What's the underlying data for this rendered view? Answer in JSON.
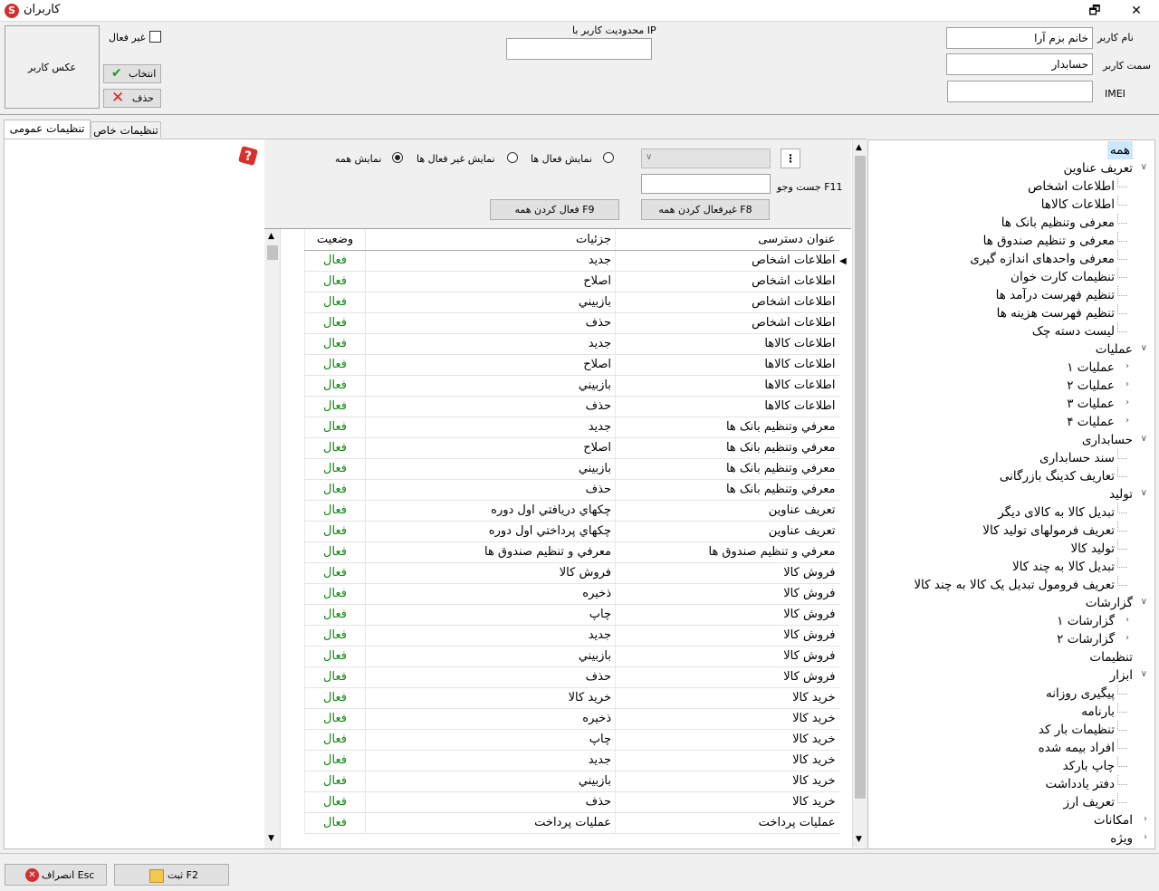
{
  "window": {
    "title": "کاربران",
    "app_logo": "S",
    "restore_glyph": "🗗",
    "close_glyph": "✕"
  },
  "header": {
    "username_label": "نام کاربر",
    "username_value": "خانم بزم آرا",
    "role_label": "سمت کاربر",
    "role_value": "حسابدار",
    "imei_label": "IMEI",
    "imei_value": "",
    "ip_label": "محدودیت کاربر با IP",
    "ip_value": "",
    "inactive_label": "غیر فعال",
    "select_button": "انتخاب",
    "delete_button": "حذف",
    "photo_label": "عکس کاربر"
  },
  "tabs": [
    {
      "label": "تنظیمات عمومی"
    },
    {
      "label": "تنظیمات خاص"
    }
  ],
  "filters": {
    "show_all": "نمایش همه",
    "show_inactive": "نمایش غیر فعال ها",
    "show_active": "نمایش فعال ها",
    "search_label": "جست وجو F11",
    "deactivate_all": "غیرفعال کردن همه F8",
    "activate_all": "فعال کردن همه F9",
    "more_glyph": "⋮"
  },
  "table": {
    "headers": {
      "title": "عنوان دسترسی",
      "details": "جزئیات",
      "status": "وضعیت"
    },
    "rows": [
      {
        "title": "اطلاعات اشخاص",
        "details": "جديد",
        "status": "فعال"
      },
      {
        "title": "اطلاعات اشخاص",
        "details": "اصلاح",
        "status": "فعال"
      },
      {
        "title": "اطلاعات اشخاص",
        "details": "بازبيني",
        "status": "فعال"
      },
      {
        "title": "اطلاعات اشخاص",
        "details": "حذف",
        "status": "فعال"
      },
      {
        "title": "اطلاعات کالاها",
        "details": "جديد",
        "status": "فعال"
      },
      {
        "title": "اطلاعات کالاها",
        "details": "اصلاح",
        "status": "فعال"
      },
      {
        "title": "اطلاعات کالاها",
        "details": "بازبيني",
        "status": "فعال"
      },
      {
        "title": "اطلاعات کالاها",
        "details": "حذف",
        "status": "فعال"
      },
      {
        "title": "معرفي وتنظيم بانک ها",
        "details": "جديد",
        "status": "فعال"
      },
      {
        "title": "معرفي وتنظيم بانک ها",
        "details": "اصلاح",
        "status": "فعال"
      },
      {
        "title": "معرفي وتنظيم بانک ها",
        "details": "بازبيني",
        "status": "فعال"
      },
      {
        "title": "معرفي وتنظيم بانک ها",
        "details": "حذف",
        "status": "فعال"
      },
      {
        "title": "تعريف عناوين",
        "details": "چکهاي دريافتي اول دوره",
        "status": "فعال"
      },
      {
        "title": "تعريف عناوين",
        "details": "چکهاي پرداختي اول دوره",
        "status": "فعال"
      },
      {
        "title": "معرفي و تنظيم صندوق ها",
        "details": "معرفي و تنظيم صندوق ها",
        "status": "فعال"
      },
      {
        "title": "فروش کالا",
        "details": "فروش کالا",
        "status": "فعال"
      },
      {
        "title": "فروش کالا",
        "details": "ذخيره",
        "status": "فعال"
      },
      {
        "title": "فروش کالا",
        "details": "چاپ",
        "status": "فعال"
      },
      {
        "title": "فروش کالا",
        "details": "جديد",
        "status": "فعال"
      },
      {
        "title": "فروش کالا",
        "details": "بازبيني",
        "status": "فعال"
      },
      {
        "title": "فروش کالا",
        "details": "حذف",
        "status": "فعال"
      },
      {
        "title": "خريد کالا",
        "details": "خريد کالا",
        "status": "فعال"
      },
      {
        "title": "خريد کالا",
        "details": "ذخيره",
        "status": "فعال"
      },
      {
        "title": "خريد کالا",
        "details": "چاپ",
        "status": "فعال"
      },
      {
        "title": "خريد کالا",
        "details": "جديد",
        "status": "فعال"
      },
      {
        "title": "خريد کالا",
        "details": "بازبيني",
        "status": "فعال"
      },
      {
        "title": "خريد کالا",
        "details": "حذف",
        "status": "فعال"
      },
      {
        "title": "عمليات پرداخت",
        "details": "عمليات پرداخت",
        "status": "فعال"
      }
    ]
  },
  "tree": [
    {
      "label": "همه",
      "level": 0,
      "toggle": "",
      "selected": true
    },
    {
      "label": "تعریف عناوین",
      "level": 0,
      "toggle": "expanded"
    },
    {
      "label": "اطلاعات اشخاص",
      "level": 1,
      "toggle": ""
    },
    {
      "label": "اطلاعات کالاها",
      "level": 1,
      "toggle": ""
    },
    {
      "label": "معرفی وتنظیم بانک ها",
      "level": 1,
      "toggle": ""
    },
    {
      "label": "معرفی و تنظیم صندوق ها",
      "level": 1,
      "toggle": ""
    },
    {
      "label": "معرفی واحدهای اندازه گیری",
      "level": 1,
      "toggle": ""
    },
    {
      "label": "تنظیمات کارت خوان",
      "level": 1,
      "toggle": ""
    },
    {
      "label": "تنظیم فهرست درآمد ها",
      "level": 1,
      "toggle": ""
    },
    {
      "label": "تنظیم فهرست هزینه ها",
      "level": 1,
      "toggle": ""
    },
    {
      "label": "لیست دسته چک",
      "level": 1,
      "toggle": ""
    },
    {
      "label": "عملیات",
      "level": 0,
      "toggle": "expanded"
    },
    {
      "label": "عملیات ۱",
      "level": 1,
      "toggle": "collapsed"
    },
    {
      "label": "عملیات ۲",
      "level": 1,
      "toggle": "collapsed"
    },
    {
      "label": "عملیات ۳",
      "level": 1,
      "toggle": "collapsed"
    },
    {
      "label": "عملیات ۴",
      "level": 1,
      "toggle": "collapsed"
    },
    {
      "label": "حسابداری",
      "level": 0,
      "toggle": "expanded"
    },
    {
      "label": "سند حسابداری",
      "level": 1,
      "toggle": ""
    },
    {
      "label": "تعاریف کدینگ بازرگانی",
      "level": 1,
      "toggle": ""
    },
    {
      "label": "تولید",
      "level": 0,
      "toggle": "expanded"
    },
    {
      "label": "تبدیل کالا به کالای دیگر",
      "level": 1,
      "toggle": ""
    },
    {
      "label": "تعریف فرمولهای تولید کالا",
      "level": 1,
      "toggle": ""
    },
    {
      "label": "تولید کالا",
      "level": 1,
      "toggle": ""
    },
    {
      "label": "تبدیل کالا به چند کالا",
      "level": 1,
      "toggle": ""
    },
    {
      "label": "تعریف فرومول تبدیل یک کالا به چند کالا",
      "level": 1,
      "toggle": ""
    },
    {
      "label": "گزارشات",
      "level": 0,
      "toggle": "expanded"
    },
    {
      "label": "گزارشات ۱",
      "level": 1,
      "toggle": "collapsed"
    },
    {
      "label": "گزارشات ۲",
      "level": 1,
      "toggle": "collapsed"
    },
    {
      "label": "تنظیمات",
      "level": 0,
      "toggle": ""
    },
    {
      "label": "ابزار",
      "level": 0,
      "toggle": "expanded"
    },
    {
      "label": "پیگیری روزانه",
      "level": 1,
      "toggle": ""
    },
    {
      "label": "بارنامه",
      "level": 1,
      "toggle": ""
    },
    {
      "label": "تنظیمات بار کد",
      "level": 1,
      "toggle": ""
    },
    {
      "label": "افراد بیمه شده",
      "level": 1,
      "toggle": ""
    },
    {
      "label": "چاپ بارکد",
      "level": 1,
      "toggle": ""
    },
    {
      "label": "دفتر یادداشت",
      "level": 1,
      "toggle": ""
    },
    {
      "label": "تعریف ارز",
      "level": 1,
      "toggle": ""
    },
    {
      "label": "امکانات",
      "level": 0,
      "toggle": "collapsed"
    },
    {
      "label": "ویژه",
      "level": 0,
      "toggle": "collapsed"
    }
  ],
  "footer": {
    "save_button": "ثبت F2",
    "cancel_button": "انصراف Esc"
  },
  "colors": {
    "status_active": "#118811",
    "selected_bg": "#cce8ff",
    "help_icon": "#d9302c"
  }
}
